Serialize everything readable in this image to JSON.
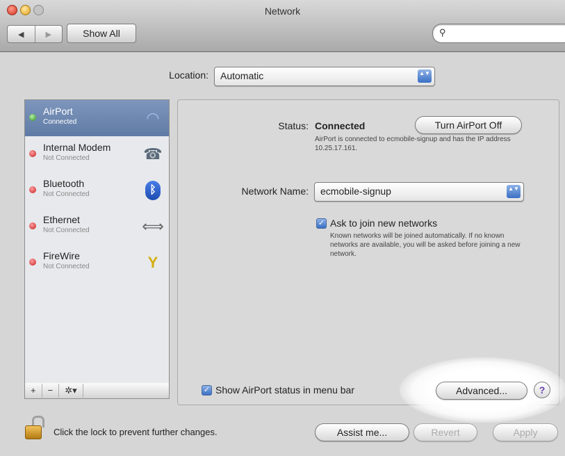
{
  "window": {
    "title": "Network",
    "back_glyph": "◀",
    "forward_glyph": "▶",
    "show_all": "Show All",
    "search_glyph": "⚲",
    "search_placeholder": ""
  },
  "location": {
    "label": "Location:",
    "value": "Automatic"
  },
  "popup_arrows": "▲▼",
  "services": [
    {
      "name": "AirPort",
      "state": "Connected",
      "status_color": "green",
      "icon": "wifi-icon",
      "glyph": "◠",
      "selected": true
    },
    {
      "name": "Internal Modem",
      "state": "Not Connected",
      "status_color": "red",
      "icon": "phone-icon",
      "glyph": "☎",
      "selected": false
    },
    {
      "name": "Bluetooth",
      "state": "Not Connected",
      "status_color": "red",
      "icon": "bluetooth-icon",
      "glyph": "ᛒ",
      "selected": false
    },
    {
      "name": "Ethernet",
      "state": "Not Connected",
      "status_color": "red",
      "icon": "ethernet-icon",
      "glyph": "⟺",
      "selected": false
    },
    {
      "name": "FireWire",
      "state": "Not Connected",
      "status_color": "red",
      "icon": "firewire-icon",
      "glyph": "Y",
      "selected": false
    }
  ],
  "sidebar_tools": {
    "add": "+",
    "remove": "−",
    "action": "✲▾"
  },
  "airport": {
    "status_label": "Status:",
    "status_value": "Connected",
    "toggle_button": "Turn AirPort Off",
    "status_desc": "AirPort is connected to ecmobile-signup and has the IP address 10.25.17.161.",
    "network_name_label": "Network Name:",
    "network_name": "ecmobile-signup",
    "ask_label": "Ask to join new networks",
    "ask_desc": "Known networks will be joined automatically. If no known networks are available, you will be asked before joining a new network.",
    "ask_checked": true,
    "show_status_label": "Show AirPort status in menu bar",
    "show_status_checked": true,
    "advanced": "Advanced...",
    "help": "?"
  },
  "footer": {
    "lock_text": "Click the lock to prevent further changes.",
    "assist": "Assist me...",
    "revert": "Revert",
    "apply": "Apply"
  },
  "check_glyph": "✓",
  "colors": {
    "selection": "#6a86b0",
    "accent": "#3a6fc4",
    "red_status": "#c41e1e",
    "green_status": "#2b8f1e"
  }
}
